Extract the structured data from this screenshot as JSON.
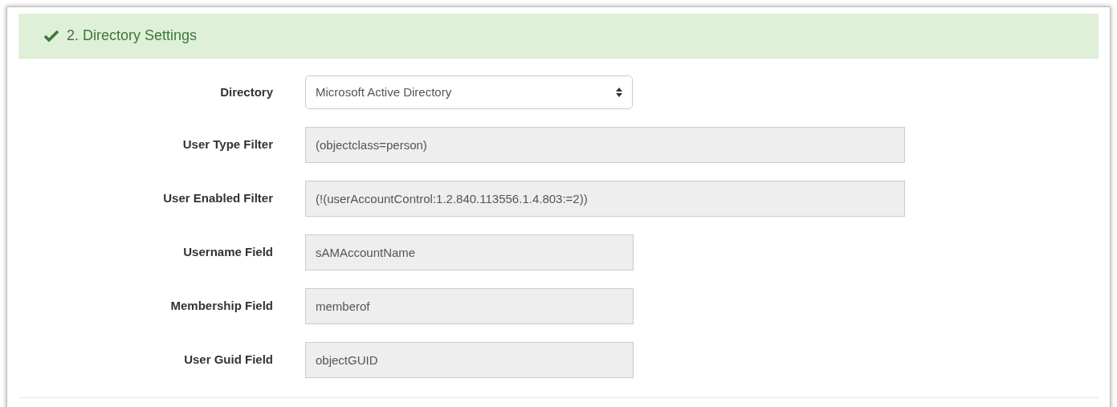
{
  "panel": {
    "title": "2. Directory Settings",
    "complete": true
  },
  "fields": [
    {
      "label": "Directory",
      "kind": "select",
      "value": "Microsoft Active Directory",
      "disabled": false
    },
    {
      "label": "User Type Filter",
      "kind": "long_text",
      "value": "(objectclass=person)",
      "disabled": true
    },
    {
      "label": "User Enabled Filter",
      "kind": "long_text",
      "value": "(!(userAccountControl:1.2.840.113556.1.4.803:=2))",
      "disabled": true
    },
    {
      "label": "Username Field",
      "kind": "short_text",
      "value": "sAMAccountName",
      "disabled": true
    },
    {
      "label": "Membership Field",
      "kind": "short_text",
      "value": "memberof",
      "disabled": true
    },
    {
      "label": "User Guid Field",
      "kind": "short_text",
      "value": "objectGUID",
      "disabled": true
    }
  ]
}
